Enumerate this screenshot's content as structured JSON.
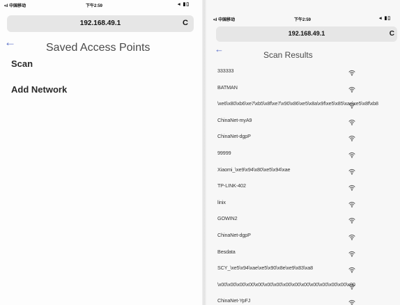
{
  "left_screen": {
    "status": {
      "carrier": "•ıl 中国移动",
      "time": "下午2:59",
      "icons": "◂ ▮▯"
    },
    "url": "192.168.49.1",
    "reload_glyph": "C",
    "back_glyph": "←",
    "title": "Saved Access Points",
    "menu": [
      {
        "label": "Scan"
      },
      {
        "label": "Add Network"
      }
    ]
  },
  "right_screen": {
    "status": {
      "carrier": "•ıl 中国移动",
      "time": "下午2:59",
      "icons": "◂ ▮▯"
    },
    "url": "192.168.49.1",
    "reload_glyph": "C",
    "back_glyph": "←",
    "title": "Scan Results",
    "access_points": [
      {
        "ssid": "333333"
      },
      {
        "ssid": "BATMAN"
      },
      {
        "ssid": "\\xe6\\x80\\xb6\\xe7\\xb5\\x8f\\xe7\\x90\\x86\\xe5\\x8a\\x9f\\xe5\\x85\\xac\\xe5\\x8f\\xb8"
      },
      {
        "ssid": "ChinaNet-myA9"
      },
      {
        "ssid": "ChinaNet-dgpP"
      },
      {
        "ssid": "99999"
      },
      {
        "ssid": "Xiaomi_\\xe9\\x94\\x80\\xe5\\x94\\xae"
      },
      {
        "ssid": "TP-LINK-402"
      },
      {
        "ssid": "linix"
      },
      {
        "ssid": "GOWIN2"
      },
      {
        "ssid": "ChinaNet-dgpP"
      },
      {
        "ssid": "Besdata"
      },
      {
        "ssid": "SCY_\\xe5\\x94\\xae\\xe5\\x90\\x8e\\xe9\\x83\\xa8"
      },
      {
        "ssid": "\\x00\\x00\\x00\\x00\\x00\\x00\\x00\\x00\\x00\\x00\\x00\\x00\\x00\\x00\\x00"
      },
      {
        "ssid": "ChinaNet-YpFJ"
      }
    ]
  }
}
